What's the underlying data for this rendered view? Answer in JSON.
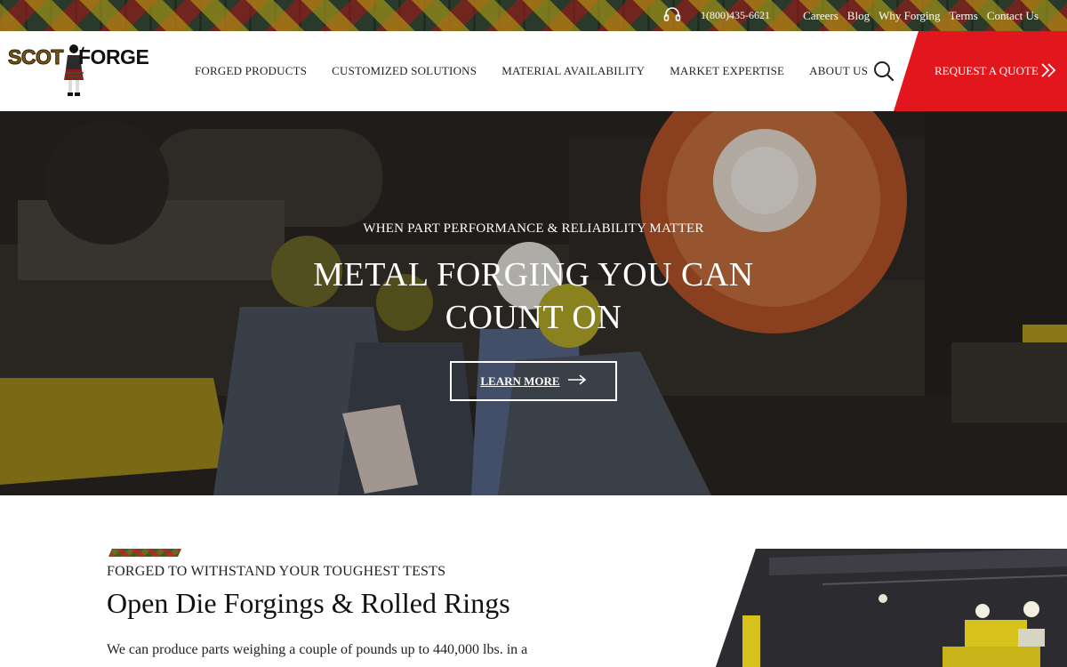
{
  "topbar": {
    "phone": "1(800)435-6621",
    "links": [
      "Careers",
      "Blog",
      "Why Forging",
      "Terms",
      "Contact Us"
    ]
  },
  "header": {
    "logo_text_left": "SCOT",
    "logo_text_right": "FORGE",
    "nav": [
      "FORGED PRODUCTS",
      "CUSTOMIZED SOLUTIONS",
      "MATERIAL AVAILABILITY",
      "MARKET EXPERTISE",
      "ABOUT US"
    ],
    "quote_label": "REQUEST A QUOTE"
  },
  "hero": {
    "eyebrow": "WHEN PART PERFORMANCE & RELIABILITY MATTER",
    "title": "METAL FORGING YOU CAN COUNT ON",
    "button_label": "LEARN MORE"
  },
  "section": {
    "eyebrow": "FORGED TO WITHSTAND YOUR TOUGHEST TESTS",
    "title": "Open Die Forgings & Rolled Rings",
    "body": "We can produce parts weighing a couple of pounds up to 440,000 lbs. in a wide range of ferrous and non-ferrous materials. Forgers in the industry"
  },
  "colors": {
    "accent_red": "#e2161d",
    "text_dark": "#222222",
    "white": "#ffffff"
  },
  "icons": {
    "phone": "headset-icon",
    "search": "search-icon",
    "quote": "double-chevron-right-icon",
    "learn_more": "arrow-right-icon"
  }
}
